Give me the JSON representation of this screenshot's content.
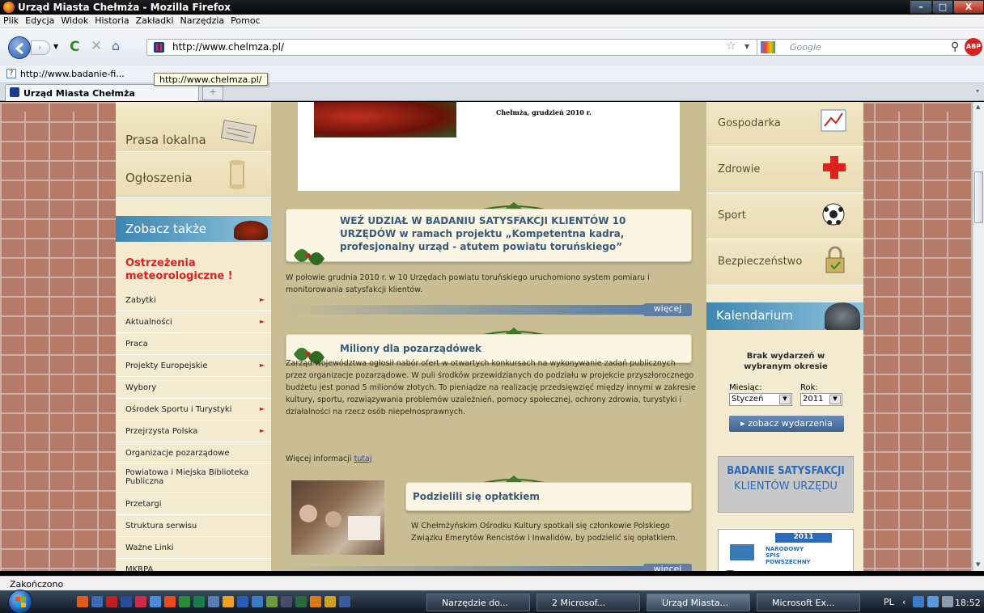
{
  "window": {
    "title": "Urząd Miasta Chełmża - Mozilla Firefox",
    "min": "–",
    "max": "□",
    "close": "X"
  },
  "menu": [
    "Plik",
    "Edycja",
    "Widok",
    "Historia",
    "Zakładki",
    "Narzędzia",
    "Pomoc"
  ],
  "nav": {
    "url": "http://www.chelmza.pl/",
    "search_placeholder": "Google",
    "abp": "ABP"
  },
  "bookmarks": {
    "item": "http://www.badanie-fi..."
  },
  "tooltip": "http://www.chelmza.pl/",
  "tab": {
    "label": "Urząd Miasta Chełmża",
    "new": "+"
  },
  "left": {
    "prasa": "Prasa lokalna",
    "ogloszenia": "Ogłoszenia",
    "zobacz": "Zobacz także",
    "ostrzezenia": "Ostrzeżenia meteorologiczne !",
    "items": [
      {
        "label": "Zabytki",
        "arrow": true
      },
      {
        "label": "Aktualności",
        "arrow": true
      },
      {
        "label": "Praca",
        "arrow": false
      },
      {
        "label": "Projekty Europejskie",
        "arrow": true
      },
      {
        "label": "Wybory",
        "arrow": false
      },
      {
        "label": "Ośrodek Sportu i Turystyki",
        "arrow": true
      },
      {
        "label": "Przejrzysta Polska",
        "arrow": true
      },
      {
        "label": "Organizacje pozarządowe",
        "arrow": false
      },
      {
        "label": "Powiatowa i Miejska Biblioteka Publiczna",
        "arrow": false
      },
      {
        "label": "Przetargi",
        "arrow": false
      },
      {
        "label": "Struktura serwisu",
        "arrow": false
      },
      {
        "label": "Ważne Linki",
        "arrow": false
      },
      {
        "label": "MKRPA",
        "arrow": false
      }
    ],
    "arrow_glyph": "►"
  },
  "center": {
    "header_caption": "Chełmża, grudzień 2010 r.",
    "a1": {
      "title": "WEŹ UDZIAŁ W BADANIU SATYSFAKCJI KLIENTÓW 10 URZĘDÓW w ramach projektu „Kompetentna kadra, profesjonalny urząd - atutem powiatu toruńskiego”",
      "text": "W połowie grudnia 2010 r. w 10 Urzędach powiatu toruńskiego uruchomiono system pomiaru i monitorowania satysfakcji klientów.",
      "more": "więcej"
    },
    "a2": {
      "title": "Miliony dla pozarządówek",
      "text": "Zarząd województwa ogłosił nabór ofert w otwartych konkursach na wykonywanie zadań publicznych przez organizacje pozarządowe. W puli środków przewidzianych do podziału w projekcie przyszłorocznego budżetu jest ponad 5 milionów złotych. To pieniądze na realizację przedsięwzięć między innymi w zakresie kultury, sportu, rozwiązywania problemów uzależnień, pomocy społecznej, ochrony zdrowia, turystyki i działalności na rzecz osób niepełnosprawnych.",
      "info": "Więcej informacji",
      "link": "tutaj"
    },
    "a3": {
      "title": "Podzielili się opłatkiem",
      "text": "W Chełmżyńskim Ośrodku Kultury spotkali się członkowie Polskiego Związku Emerytów Rencistów i Inwalidów, by podzielić się opłatkiem.",
      "more": "więcej"
    }
  },
  "right": {
    "gospodarka": "Gospodarka",
    "zdrowie": "Zdrowie",
    "sport": "Sport",
    "bezpieczenstwo": "Bezpieczeństwo",
    "kalendarium": "Kalendarium",
    "brak": "Brak wydarzeń w wybranym okresie",
    "miesiac_label": "Miesiąc:",
    "miesiac": "Styczeń",
    "rok_label": "Rok:",
    "rok": "2011",
    "zobacz": "▸ zobacz wydarzenia",
    "badanie1": "BADANIE SATYSFAKCJI",
    "badanie2": "KLIENTÓW URZĘDU",
    "spis_year": "2011",
    "spis1": "NARODOWY",
    "spis2": "SPIS",
    "spis3": "POWSZECHNY",
    "spis_logo": "gus"
  },
  "status": "Zakończono",
  "taskbar": {
    "items": [
      "Narzędzie do...",
      "2 Microsof...",
      "Urząd Miasta...",
      "Microsoft Ex..."
    ],
    "lang": "PL",
    "time": "18:52"
  },
  "colors": {
    "accent": "#4d75a6",
    "alert": "#e0201a",
    "title": "#3a5a78"
  }
}
